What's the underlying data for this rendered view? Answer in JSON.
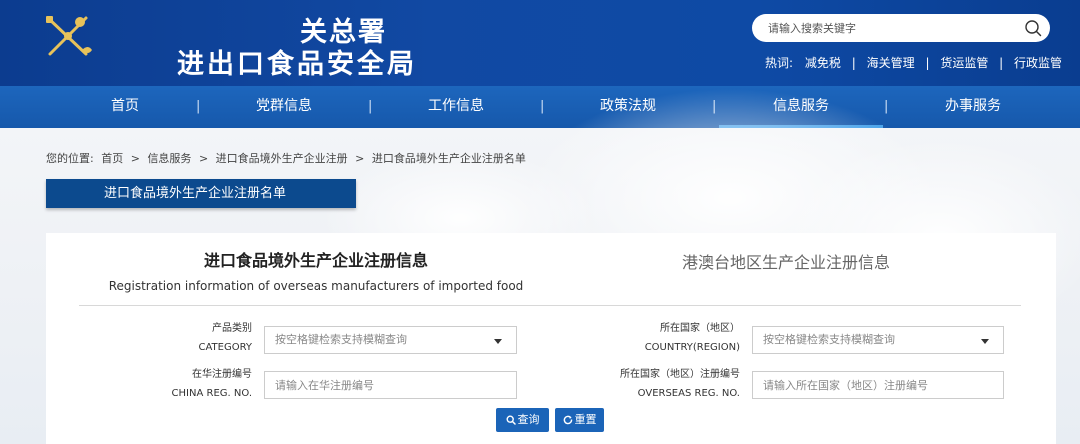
{
  "header": {
    "title_top": "海关总署",
    "title_top_visible": "关总署",
    "title": "进出口食品安全局",
    "search_placeholder": "请输入搜索关键字",
    "hot_label": "热词:",
    "hot_words": [
      "减免税",
      "海关管理",
      "货运监管",
      "行政监管"
    ]
  },
  "nav": {
    "items": [
      "首页",
      "党群信息",
      "工作信息",
      "政策法规",
      "信息服务",
      "办事服务"
    ],
    "active": "信息服务"
  },
  "breadcrumb": {
    "prefix": "您的位置:",
    "items": [
      "首页",
      "信息服务",
      "进口食品境外生产企业注册",
      "进口食品境外生产企业注册名单"
    ],
    "separator": ">"
  },
  "section_tab": "进口食品境外生产企业注册名单",
  "tabs": {
    "main_cn": "进口食品境外生产企业注册信息",
    "main_en": "Registration information of overseas manufacturers of imported food",
    "other": "港澳台地区生产企业注册信息"
  },
  "form": {
    "category_cn": "产品类别",
    "category_en": "CATEGORY",
    "category_placeholder": "按空格键检索支持模糊查询",
    "country_cn": "所在国家（地区）",
    "country_en": "COUNTRY(REGION)",
    "country_placeholder": "按空格键检索支持模糊查询",
    "china_reg_cn": "在华注册编号",
    "china_reg_en": "CHINA REG. NO.",
    "china_reg_placeholder": "请输入在华注册编号",
    "overseas_reg_cn": "所在国家（地区）注册编号",
    "overseas_reg_en": "OVERSEAS REG. NO.",
    "overseas_reg_placeholder": "请输入所在国家（地区）注册编号",
    "search_label": "查询",
    "reset_label": "重置"
  },
  "colors": {
    "header_bg": "#0c3c8f",
    "nav_bg": "#1a5fb4",
    "accent": "#1b64b8",
    "section_tab_bg": "#0c4a8e"
  }
}
